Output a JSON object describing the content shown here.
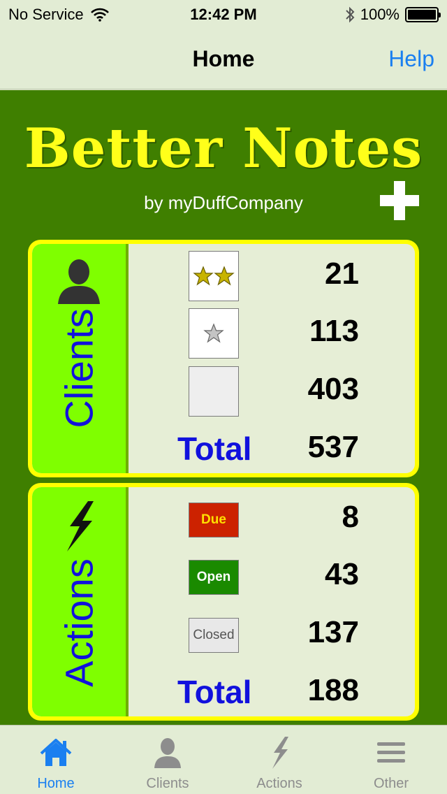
{
  "status_bar": {
    "carrier": "No Service",
    "time": "12:42 PM",
    "battery": "100%"
  },
  "nav": {
    "title": "Home",
    "help_label": "Help"
  },
  "app": {
    "title": "Better Notes",
    "byline": "by myDuffCompany"
  },
  "clients": {
    "label": "Clients",
    "rows": [
      {
        "icon": "two-stars-icon",
        "value": "21"
      },
      {
        "icon": "one-star-icon",
        "value": "113"
      },
      {
        "icon": "no-star-icon",
        "value": "403"
      }
    ],
    "total_label": "Total",
    "total_value": "537"
  },
  "actions": {
    "label": "Actions",
    "rows": [
      {
        "badge": "Due",
        "value": "8"
      },
      {
        "badge": "Open",
        "value": "43"
      },
      {
        "badge": "Closed",
        "value": "137"
      }
    ],
    "total_label": "Total",
    "total_value": "188"
  },
  "tabbar": {
    "items": [
      {
        "label": "Home",
        "icon": "home-icon",
        "active": true
      },
      {
        "label": "Clients",
        "icon": "person-icon",
        "active": false
      },
      {
        "label": "Actions",
        "icon": "lightning-icon",
        "active": false
      },
      {
        "label": "Other",
        "icon": "menu-icon",
        "active": false
      }
    ]
  },
  "colors": {
    "background_green": "#3f7f00",
    "logo_yellow": "#ffff1a",
    "panel_border": "#ffff00",
    "side_green": "#7fff00",
    "label_blue": "#1111dd",
    "tint_blue": "#1a7ff0",
    "due_red": "#cc2200",
    "open_green": "#1a8a00"
  }
}
